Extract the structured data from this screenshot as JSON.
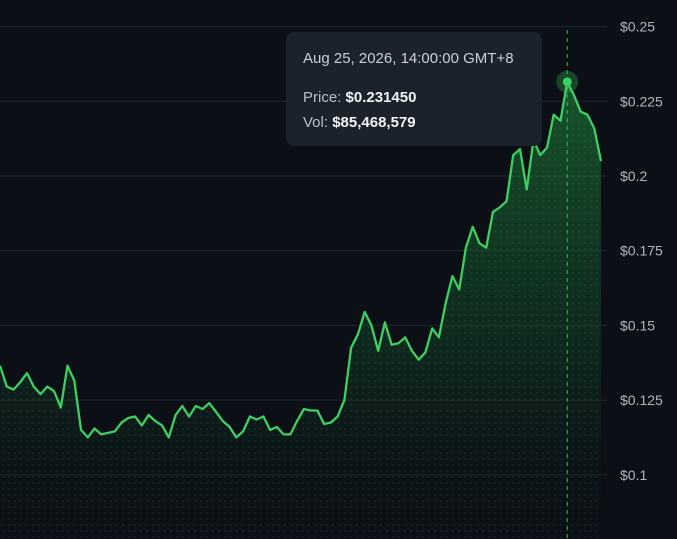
{
  "chart_data": {
    "type": "area",
    "title": "",
    "xlabel": "",
    "ylabel": "",
    "ylim": [
      0.0785,
      0.2589
    ],
    "y_ticks": [
      {
        "value": 0.25,
        "label": "$0.25"
      },
      {
        "value": 0.225,
        "label": "$0.225"
      },
      {
        "value": 0.2,
        "label": "$0.2"
      },
      {
        "value": 0.175,
        "label": "$0.175"
      },
      {
        "value": 0.15,
        "label": "$0.15"
      },
      {
        "value": 0.125,
        "label": "$0.125"
      },
      {
        "value": 0.1,
        "label": "$0.1"
      }
    ],
    "grid": true,
    "line_color": "#3ecf63",
    "background": "#0c1016",
    "series": [
      {
        "values": [
          0.1365,
          0.1295,
          0.1285,
          0.131,
          0.134,
          0.1295,
          0.127,
          0.1295,
          0.128,
          0.1225,
          0.1365,
          0.1315,
          0.115,
          0.1125,
          0.1155,
          0.1135,
          0.114,
          0.1145,
          0.1175,
          0.119,
          0.1195,
          0.1165,
          0.12,
          0.118,
          0.1165,
          0.1125,
          0.12,
          0.123,
          0.1195,
          0.123,
          0.122,
          0.124,
          0.121,
          0.118,
          0.116,
          0.1125,
          0.1145,
          0.1195,
          0.1185,
          0.1195,
          0.115,
          0.116,
          0.1135,
          0.1135,
          0.118,
          0.122,
          0.1215,
          0.1215,
          0.117,
          0.1175,
          0.1195,
          0.125,
          0.1425,
          0.147,
          0.1545,
          0.15,
          0.1415,
          0.151,
          0.1435,
          0.144,
          0.146,
          0.1415,
          0.1385,
          0.141,
          0.149,
          0.146,
          0.1575,
          0.1665,
          0.162,
          0.176,
          0.183,
          0.1775,
          0.176,
          0.188,
          0.1895,
          0.1915,
          0.207,
          0.209,
          0.1955,
          0.212,
          0.207,
          0.2095,
          0.2205,
          0.2185,
          0.2315,
          0.227,
          0.2215,
          0.2205,
          0.216,
          0.205
        ]
      }
    ],
    "highlight_index": 84
  },
  "tooltip": {
    "date": "Aug 25, 2026, 14:00:00 GMT+8",
    "price_label": "Price:",
    "price_value": "$0.231450",
    "vol_label": "Vol:",
    "vol_value": "$85,468,579"
  }
}
